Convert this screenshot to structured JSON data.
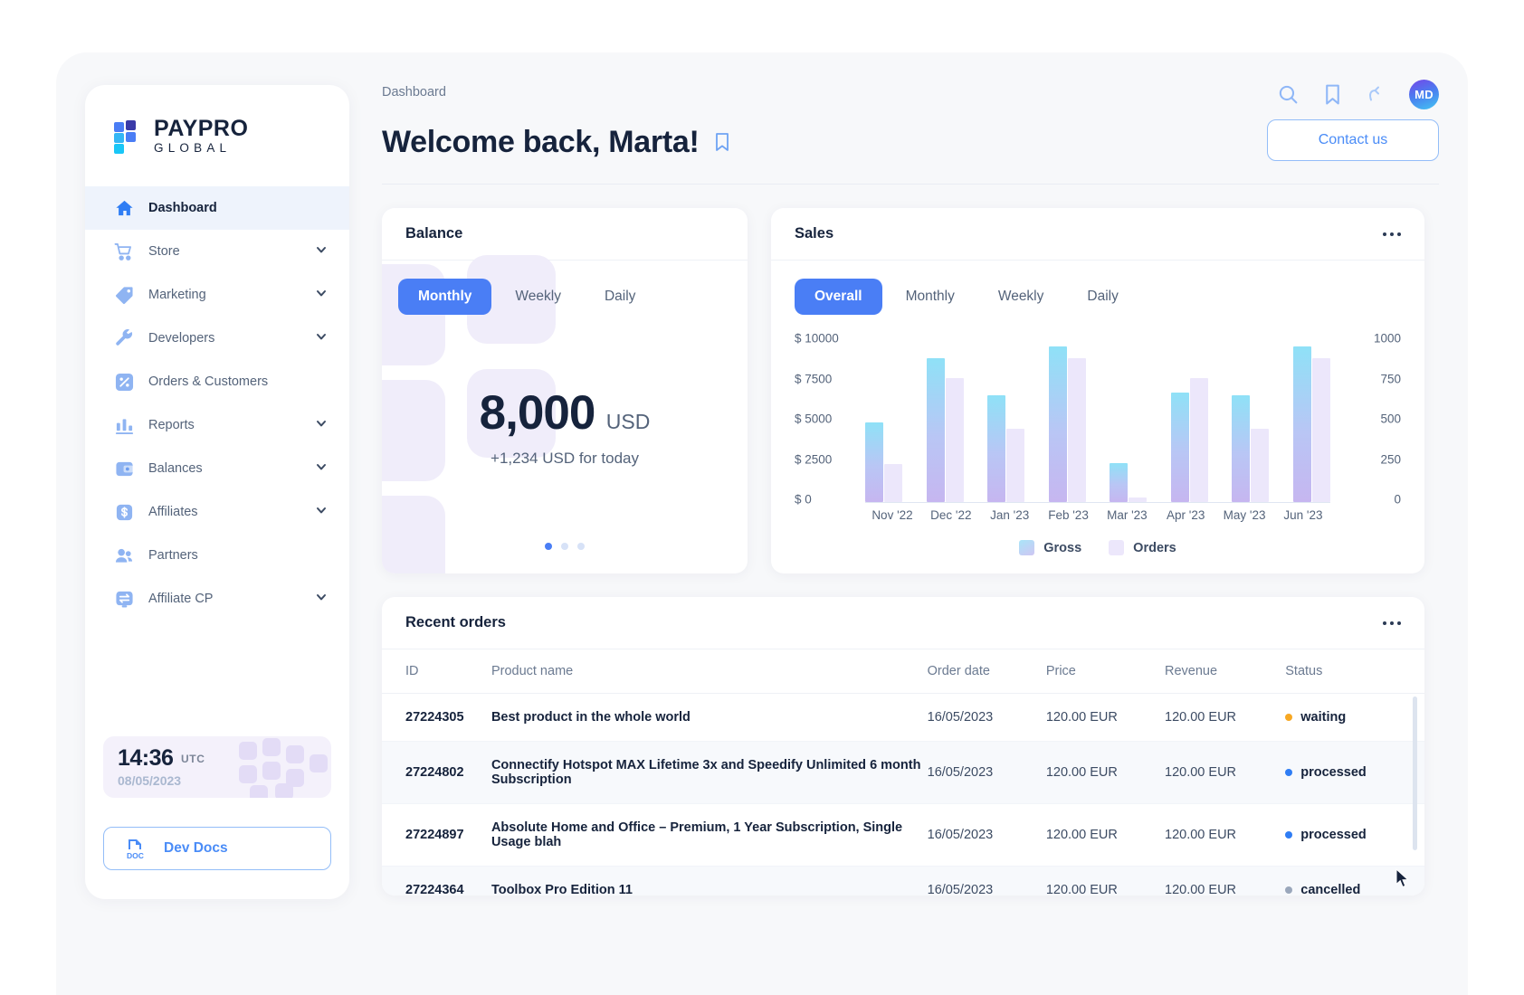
{
  "brand": {
    "name_line1": "PAYPRO",
    "name_line2": "GLOBAL"
  },
  "sidebar": {
    "items": [
      {
        "label": "Dashboard",
        "icon": "home-icon",
        "active": true,
        "chevron": false
      },
      {
        "label": "Store",
        "icon": "cart-icon",
        "active": false,
        "chevron": true
      },
      {
        "label": "Marketing",
        "icon": "tag-icon",
        "active": false,
        "chevron": true
      },
      {
        "label": "Developers",
        "icon": "wrench-icon",
        "active": false,
        "chevron": true
      },
      {
        "label": "Orders & Customers",
        "icon": "percent-icon",
        "active": false,
        "chevron": false
      },
      {
        "label": "Reports",
        "icon": "bar-chart-icon",
        "active": false,
        "chevron": true
      },
      {
        "label": "Balances",
        "icon": "wallet-icon",
        "active": false,
        "chevron": true
      },
      {
        "label": "Affiliates",
        "icon": "dollar-icon",
        "active": false,
        "chevron": true
      },
      {
        "label": "Partners",
        "icon": "people-icon",
        "active": false,
        "chevron": false
      },
      {
        "label": "Affiliate CP",
        "icon": "exchange-icon",
        "active": false,
        "chevron": true
      }
    ],
    "clock": {
      "time": "14:36",
      "timezone": "UTC",
      "date": "08/05/2023"
    },
    "dev_docs": {
      "label": "Dev Docs",
      "icon": "doc-icon",
      "badge": "DOC"
    }
  },
  "header": {
    "breadcrumb": "Dashboard",
    "title": "Welcome back, Marta!",
    "bookmark_icon": "bookmark-icon",
    "contact_label": "Contact us",
    "icons": [
      "search-icon",
      "bookmark-icon",
      "refresh-icon"
    ],
    "avatar_initials": "MD"
  },
  "balance": {
    "title": "Balance",
    "tabs": [
      {
        "label": "Monthly",
        "active": true
      },
      {
        "label": "Weekly",
        "active": false
      },
      {
        "label": "Daily",
        "active": false
      }
    ],
    "amount": "8,000",
    "currency": "USD",
    "subtext": "+1,234 USD for today",
    "carousel": {
      "count": 3,
      "active_index": 0
    }
  },
  "sales": {
    "title": "Sales",
    "menu_icon": "more-horizontal-icon",
    "tabs": [
      {
        "label": "Overall",
        "active": true
      },
      {
        "label": "Monthly",
        "active": false
      },
      {
        "label": "Weekly",
        "active": false
      },
      {
        "label": "Daily",
        "active": false
      }
    ]
  },
  "chart_data": {
    "type": "bar",
    "title": "Sales",
    "categories": [
      "Nov '22",
      "Dec '22",
      "Jan '23",
      "Feb '23",
      "Mar '23",
      "Apr '23",
      "May '23",
      "Jun '23"
    ],
    "series": [
      {
        "name": "Gross",
        "axis": "left",
        "color": "#9fd8f5",
        "values": [
          5200,
          9400,
          7000,
          10200,
          2550,
          7150,
          7000,
          10200
        ]
      },
      {
        "name": "Orders",
        "axis": "right",
        "color": "#ece7fb",
        "values": [
          250,
          810,
          480,
          940,
          30,
          810,
          480,
          940
        ]
      }
    ],
    "left_axis": {
      "label": "",
      "ticks": [
        "$ 10000",
        "$ 7500",
        "$ 5000",
        "$ 2500",
        "$ 0"
      ],
      "min": 0,
      "max": 11000
    },
    "right_axis": {
      "label": "",
      "ticks": [
        "1000",
        "750",
        "500",
        "250",
        "0"
      ],
      "min": 0,
      "max": 1100
    },
    "xlabel": "",
    "ylabel": "",
    "grid": false,
    "legend_position": "bottom"
  },
  "orders": {
    "title": "Recent orders",
    "menu_icon": "more-horizontal-icon",
    "columns": [
      "ID",
      "Product name",
      "Order date",
      "Price",
      "Revenue",
      "Status"
    ],
    "rows": [
      {
        "id": "27224305",
        "product": "Best product in the whole world",
        "date": "16/05/2023",
        "price": "120.00 EUR",
        "revenue": "120.00 EUR",
        "status": "waiting",
        "status_color": "#f7a823"
      },
      {
        "id": "27224802",
        "product": "Connectify Hotspot MAX Lifetime 3x and Speedify Unlimited 6 month Subscription",
        "date": "16/05/2023",
        "price": "120.00 EUR",
        "revenue": "120.00 EUR",
        "status": "processed",
        "status_color": "#2f7df4"
      },
      {
        "id": "27224897",
        "product": "Absolute Home and Office – Premium, 1 Year Subscription, Single Usage blah",
        "date": "16/05/2023",
        "price": "120.00 EUR",
        "revenue": "120.00 EUR",
        "status": "processed",
        "status_color": "#2f7df4"
      },
      {
        "id": "27224364",
        "product": "Toolbox Pro Edition 11",
        "date": "16/05/2023",
        "price": "120.00 EUR",
        "revenue": "120.00 EUR",
        "status": "cancelled",
        "status_color": "#9aa7bb"
      }
    ]
  },
  "colors": {
    "accent": "#4a7ef5",
    "accent_light": "#93bdf8",
    "text_dark": "#16233c",
    "text_muted": "#54637a",
    "bg": "#f7f8fa"
  }
}
